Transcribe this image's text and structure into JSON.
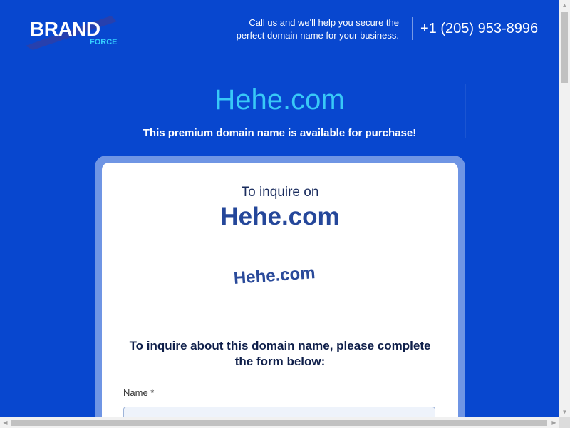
{
  "header": {
    "logo": {
      "main": "BRAND",
      "sub": "FORCE"
    },
    "tagline_line1": "Call us and we'll help you secure the",
    "tagline_line2": "perfect domain name for your business.",
    "phone": "+1 (205) 953-8996"
  },
  "hero": {
    "title": "Hehe.com",
    "subtitle": "This premium domain name is available for purchase!"
  },
  "card": {
    "inquire_label": "To inquire on",
    "domain": "Hehe.com",
    "domain_logo_text": "Hehe.com",
    "form_heading_line1": "To inquire about this domain name, please complete",
    "form_heading_line2": "the form below:",
    "fields": [
      {
        "label": "Name *",
        "value": "",
        "placeholder": ""
      }
    ]
  },
  "colors": {
    "background": "#0847cf",
    "hero_title": "#38c9f7",
    "card_frame": "#6f95e4",
    "domain_text": "#25479a"
  },
  "icons": {
    "scroll_up": "▲",
    "scroll_down": "▼",
    "scroll_left": "◀",
    "scroll_right": "▶"
  }
}
